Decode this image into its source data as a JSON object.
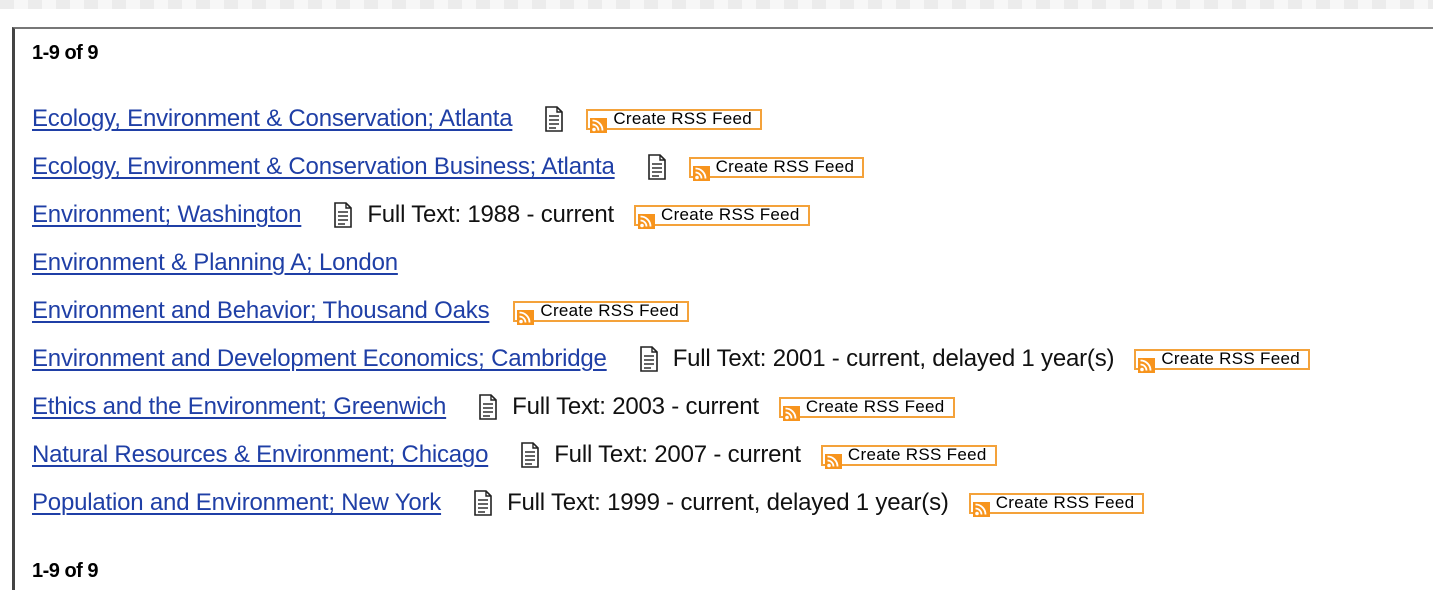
{
  "pagination": {
    "top": "1-9 of 9",
    "bottom": "1-9 of 9"
  },
  "rss_label": "Create RSS Feed",
  "icons": {
    "document": "document-icon",
    "rss": "rss-icon"
  },
  "colors": {
    "link": "#1f3fa6",
    "rss_border": "#f4a23a",
    "rss_icon": "#f7941d"
  },
  "results": [
    {
      "title": "Ecology, Environment & Conservation; Atlanta",
      "has_doc": true,
      "fulltext": "",
      "has_rss": true
    },
    {
      "title": "Ecology, Environment & Conservation Business; Atlanta",
      "has_doc": true,
      "fulltext": "",
      "has_rss": true
    },
    {
      "title": "Environment; Washington",
      "has_doc": true,
      "fulltext": "Full Text: 1988 - current",
      "has_rss": true
    },
    {
      "title": "Environment & Planning A; London",
      "has_doc": false,
      "fulltext": "",
      "has_rss": false
    },
    {
      "title": "Environment and Behavior; Thousand Oaks",
      "has_doc": false,
      "fulltext": "",
      "has_rss": true
    },
    {
      "title": "Environment and Development Economics; Cambridge",
      "has_doc": true,
      "fulltext": "Full Text: 2001 - current, delayed 1 year(s)",
      "has_rss": true
    },
    {
      "title": "Ethics and the Environment; Greenwich",
      "has_doc": true,
      "fulltext": "Full Text: 2003 - current",
      "has_rss": true
    },
    {
      "title": "Natural Resources & Environment; Chicago",
      "has_doc": true,
      "fulltext": "Full Text: 2007 - current",
      "has_rss": true
    },
    {
      "title": "Population and Environment; New York",
      "has_doc": true,
      "fulltext": "Full Text: 1999 - current, delayed 1 year(s)",
      "has_rss": true
    }
  ]
}
